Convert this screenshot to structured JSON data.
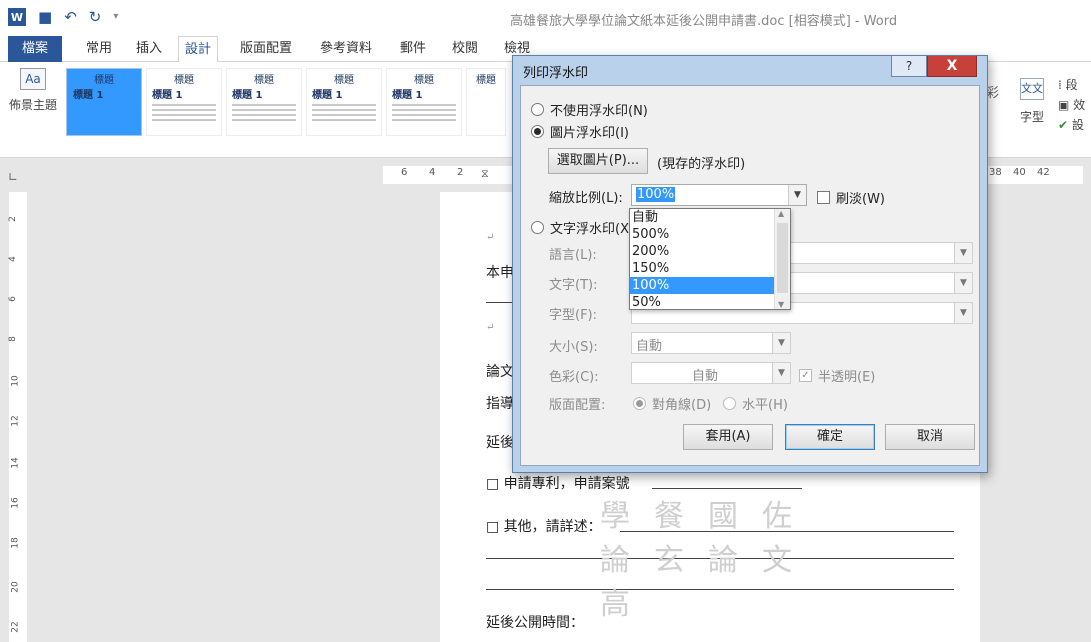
{
  "window": {
    "title": "高雄餐旅大學學位論文紙本延後公開申請書.doc [相容模式] - Word"
  },
  "ribbon": {
    "file_tab": "檔案",
    "tabs": [
      "常用",
      "插入",
      "設計",
      "版面配置",
      "參考資料",
      "郵件",
      "校閱",
      "檢視"
    ],
    "active_tab": "設計",
    "theme_label": "佈景主題",
    "gallery_title": "標題",
    "gallery_heading": "標題 1",
    "right_partial": {
      "hidden_label": "彩",
      "fonts_label": "字型",
      "item1": "段",
      "item2": "效",
      "item3": "設"
    }
  },
  "ruler": {
    "ticks": [
      "6",
      "4",
      "2",
      "38",
      "40",
      "42"
    ],
    "vticks": [
      "2",
      "4",
      "6",
      "8",
      "10",
      "12",
      "14",
      "16",
      "18",
      "20",
      "22"
    ]
  },
  "document": {
    "line_ben": "本申",
    "line_lunwen": "論文",
    "line_zhidao": "指導",
    "line_yanhou": "延後",
    "patent": "□ 申請專利，申請案號",
    "other": "□ 其他，請詳述：",
    "delay_time": "延後公開時間："
  },
  "dialog": {
    "title": "列印浮水印",
    "help": "?",
    "close": "X",
    "no_watermark": "不使用浮水印(N)",
    "picture_watermark": "圖片浮水印(I)",
    "select_picture": "選取圖片(P)...",
    "current_watermark": "(現存的浮水印)",
    "scale_label": "縮放比例(L):",
    "scale_value": "100%",
    "washout": "刷淡(W)",
    "text_watermark": "文字浮水印(X)",
    "language_label": "語言(L):",
    "text_label": "文字(T):",
    "font_label": "字型(F):",
    "size_label": "大小(S):",
    "size_value": "自動",
    "color_label": "色彩(C):",
    "color_value": "自動",
    "semitransparent": "半透明(E)",
    "layout_label": "版面配置:",
    "diagonal": "對角線(D)",
    "horizontal": "水平(H)",
    "apply": "套用(A)",
    "ok": "確定",
    "cancel": "取消"
  },
  "scale_dropdown": {
    "options": [
      "自動",
      "500%",
      "200%",
      "150%",
      "100%",
      "50%"
    ],
    "highlighted": "100%"
  },
  "watermark_chars": "學餐國佐論玄論文高"
}
